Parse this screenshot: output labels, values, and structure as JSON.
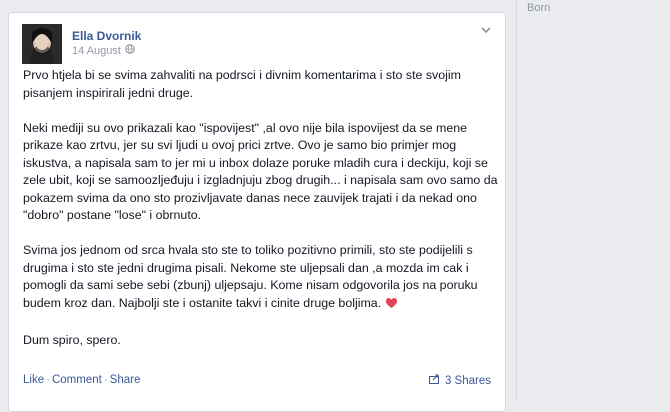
{
  "post": {
    "author": "Ella Dvornik",
    "date": "14 August",
    "paragraphs": [
      "Prvo htjela bi se svima zahvaliti na podrsci i divnim komentarima i sto ste svojim pisanjem inspirirali jedni druge.",
      "Neki mediji su ovo prikazali kao \"ispovijest\" ,al ovo nije bila ispovijest da se mene prikaze kao zrtvu, jer su svi ljudi u ovoj prici zrtve. Ovo je samo bio primjer mog iskustva, a napisala sam to jer mi u inbox dolaze poruke mladih cura i deckiju, koji se zele ubit, koji se samoozljeđuju i izgladnjuju zbog drugih... i napisala sam ovo samo da pokazem svima da ono sto prozivljavate danas nece zauvijek trajati i da nekad ono \"dobro\" postane \"lose\" i obrnuto.",
      "Svima jos jednom od srca hvala sto ste to toliko pozitivno primili, sto ste podijelili s drugima i sto ste jedni drugima pisali. Nekome ste uljepsali dan ,a mozda im cak i pomogli da sami sebe sebi (zbunj) uljepsaju. Kome nisam odgovorila jos na poruku budem kroz dan. Najbolji ste i ostanite takvi i cinite druge boljima.",
      "Dum spiro, spero."
    ],
    "actions": {
      "like": "Like",
      "comment": "Comment",
      "share": "Share",
      "sep": "·"
    },
    "shares": "3 Shares"
  },
  "sidebar": {
    "label": "Born"
  },
  "colors": {
    "link": "#3b5998",
    "muted": "#9197a3",
    "heart": "#e0455b"
  },
  "icons": [
    "globe-icon",
    "chevron-down-icon",
    "heart-icon",
    "share-icon"
  ]
}
